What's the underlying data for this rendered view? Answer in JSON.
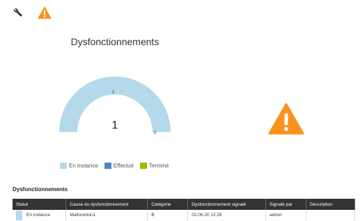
{
  "toolbar": {
    "icons": [
      "wrench-icon",
      "warning-icon"
    ]
  },
  "colors": {
    "accent_orange": "#f7941d",
    "en_instance": "#b4d9ea",
    "effectue": "#4a86c5",
    "termine": "#a8b400",
    "table_header": "#333333"
  },
  "gauge": {
    "title": "Dysfonctionnements",
    "value": "1",
    "max_label": "1",
    "min_label": "0",
    "fill_fraction": 1.0
  },
  "legend": [
    {
      "label": "En instance",
      "color": "#b4d9ea"
    },
    {
      "label": "Effectué",
      "color": "#4a86c5"
    },
    {
      "label": "Terminé",
      "color": "#a8b400"
    }
  ],
  "big_icon": "warning-icon",
  "table": {
    "title": "Dysfonctionnements",
    "columns": [
      "Statut",
      "Cause du dysfonctionnement",
      "Catégorie",
      "Dysfonctionnement signalé",
      "Signalé par",
      "Description"
    ],
    "rows": [
      [
        "En instance",
        "Malfunction1",
        "B",
        "02.06.20 12:28",
        "admin",
        ""
      ]
    ]
  }
}
